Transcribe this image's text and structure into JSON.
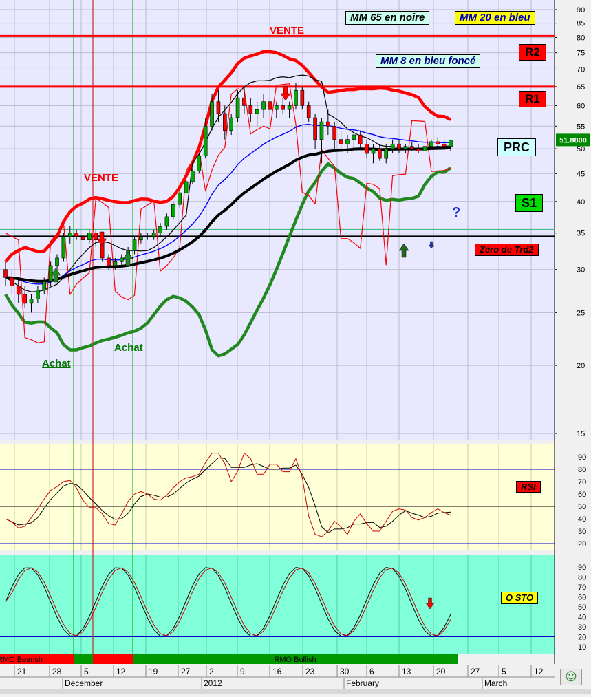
{
  "chart_data": [
    {
      "type": "candlestick",
      "title": "",
      "ylim": [
        15,
        90
      ],
      "y_scale": "log",
      "y_ticks": [
        15,
        20,
        25,
        30,
        35,
        40,
        45,
        50,
        55,
        60,
        65,
        70,
        75,
        80,
        85,
        90
      ],
      "last_price": "51.8800",
      "x_labels": [
        "21",
        "28",
        "5",
        "12",
        "19",
        "27",
        "2",
        "9",
        "16",
        "23",
        "30",
        "6",
        "13",
        "20",
        "27",
        "5",
        "12"
      ],
      "month_labels": [
        "December",
        "2012",
        "February",
        "March"
      ],
      "legend": {
        "mm65": "MM 65 en noire",
        "mm20": "MM 20 en bleu",
        "mm8": "MM 8 en bleu foncé"
      },
      "levels": [
        {
          "name": "R2",
          "value": 80.5,
          "color": "#ff0000"
        },
        {
          "name": "R1",
          "value": 65,
          "color": "#ff0000"
        },
        {
          "name": "PRC",
          "value": 50.5,
          "color": "#ccffff"
        },
        {
          "name": "S1",
          "value": 39.5,
          "color": "#00cc00"
        },
        {
          "name": "Zéro de Trd2",
          "value": 34.5,
          "color": "#ff0000"
        }
      ],
      "annotations": [
        "VENTE",
        "VENTE",
        "Achat",
        "Achat",
        "?"
      ],
      "candles": [
        [
          30,
          31,
          28,
          29
        ],
        [
          29,
          30,
          27,
          28
        ],
        [
          28,
          29,
          26,
          27
        ],
        [
          27,
          28,
          25.5,
          26
        ],
        [
          26,
          27,
          25,
          26.5
        ],
        [
          26.5,
          28,
          26,
          27.5
        ],
        [
          27.5,
          29,
          27,
          28.5
        ],
        [
          28.5,
          31,
          28,
          30.5
        ],
        [
          30.5,
          32,
          30,
          31.5
        ],
        [
          31.5,
          35,
          31,
          34.5
        ],
        [
          34.5,
          36,
          33.5,
          35
        ],
        [
          35,
          35.5,
          34,
          34.5
        ],
        [
          34.5,
          35,
          33.5,
          34
        ],
        [
          34,
          35.5,
          33.5,
          35
        ],
        [
          35,
          35.5,
          33,
          34
        ],
        [
          34,
          34.5,
          31,
          31.5
        ],
        [
          31.5,
          32,
          30,
          30.5
        ],
        [
          30.5,
          31.5,
          30,
          31
        ],
        [
          31,
          32,
          30.5,
          31.5
        ],
        [
          31.5,
          33,
          31,
          32.5
        ],
        [
          32.5,
          34.5,
          32,
          34
        ],
        [
          34,
          35,
          33.5,
          34.5
        ],
        [
          34.5,
          35,
          34,
          34.5
        ],
        [
          34.5,
          35.5,
          34,
          35
        ],
        [
          35,
          36.5,
          34.5,
          36
        ],
        [
          36,
          38,
          35.5,
          37.5
        ],
        [
          37.5,
          40,
          37,
          39.5
        ],
        [
          39.5,
          42,
          39,
          41.5
        ],
        [
          41.5,
          44,
          41,
          43.5
        ],
        [
          43.5,
          46,
          43,
          45.5
        ],
        [
          45.5,
          49,
          45,
          48.5
        ],
        [
          48.5,
          57,
          48,
          55
        ],
        [
          55,
          63,
          54,
          61
        ],
        [
          61,
          64,
          56,
          58
        ],
        [
          58,
          60,
          52,
          54
        ],
        [
          54,
          58,
          53,
          57
        ],
        [
          57,
          64,
          56,
          62
        ],
        [
          62,
          65,
          58,
          60
        ],
        [
          60,
          62,
          56,
          58
        ],
        [
          58,
          61,
          55,
          59
        ],
        [
          59,
          63,
          57,
          61
        ],
        [
          61,
          62,
          57,
          59
        ],
        [
          59,
          61,
          57,
          60
        ],
        [
          60,
          62,
          58,
          59
        ],
        [
          59,
          61,
          57,
          60
        ],
        [
          60,
          66,
          59,
          64
        ],
        [
          64,
          65,
          59,
          60
        ],
        [
          60,
          61,
          56,
          57
        ],
        [
          57,
          58,
          50,
          52
        ],
        [
          52,
          57,
          47,
          56
        ],
        [
          56,
          59,
          53,
          55
        ],
        [
          55,
          56,
          50,
          52
        ],
        [
          52,
          54,
          49,
          51
        ],
        [
          51,
          53,
          49,
          52
        ],
        [
          52,
          54,
          50,
          53
        ],
        [
          53,
          54,
          50,
          51
        ],
        [
          51,
          52,
          48,
          49
        ],
        [
          49,
          51,
          47,
          50
        ],
        [
          50,
          51,
          47.5,
          48
        ],
        [
          48,
          51,
          47,
          50
        ],
        [
          50,
          52,
          49,
          51
        ],
        [
          51,
          52,
          49,
          50
        ],
        [
          50,
          51,
          49,
          50.5
        ],
        [
          50.5,
          51.5,
          49.5,
          50
        ],
        [
          50,
          51,
          49,
          49.5
        ],
        [
          49.5,
          51,
          49,
          50.5
        ],
        [
          50.5,
          52,
          50,
          51.5
        ],
        [
          51.5,
          52.5,
          50.5,
          51
        ],
        [
          51,
          52,
          50,
          50.5
        ],
        [
          50.5,
          52,
          49.5,
          51.88
        ]
      ]
    },
    {
      "type": "line",
      "title": "RSI",
      "ylim": [
        15,
        95
      ],
      "y_ticks": [
        20,
        30,
        40,
        50,
        60,
        70,
        80,
        90
      ],
      "ref_lines": [
        80,
        50,
        20
      ]
    },
    {
      "type": "line",
      "title": "O STO",
      "ylim": [
        10,
        95
      ],
      "y_ticks": [
        10,
        20,
        30,
        40,
        50,
        60,
        70,
        80,
        90
      ],
      "ref_lines": [
        80,
        20
      ]
    },
    {
      "type": "band",
      "segments": [
        {
          "label": "RMO Bearish",
          "color": "#ff0000"
        },
        {
          "label": "",
          "color": "#009900"
        },
        {
          "label": "",
          "color": "#ff0000"
        },
        {
          "label": "RMO Bullish",
          "color": "#009900"
        }
      ]
    }
  ],
  "colors": {
    "price_bg": "#e8e8ff",
    "rsi_bg": "#ffffd8",
    "sto_bg": "#80ffd8",
    "mm65": "#000000",
    "mm20": "#0000ff",
    "mm8": "#000080",
    "bull_candle": "#00aa00",
    "bear_candle": "#ff0000"
  },
  "icons": {
    "status": "smiley-icon"
  }
}
